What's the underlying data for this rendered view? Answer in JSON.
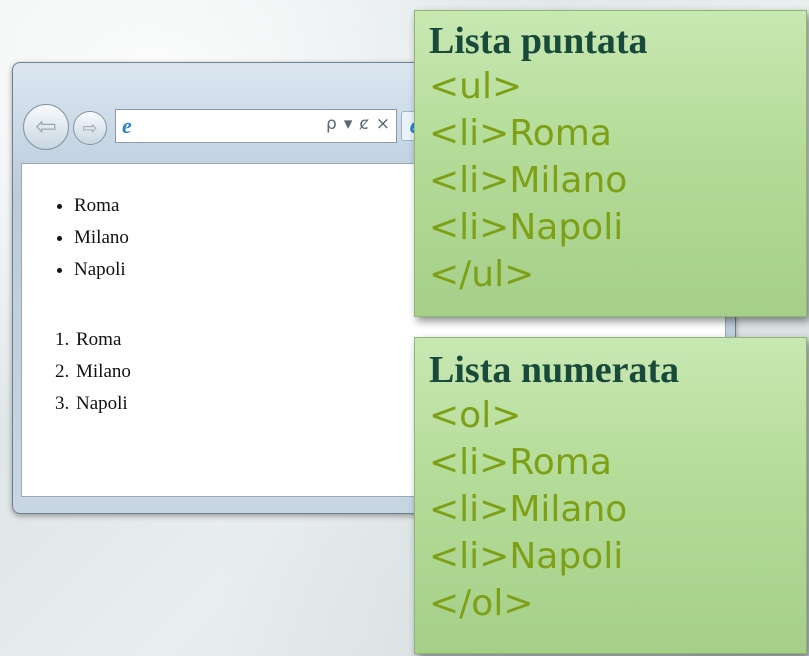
{
  "browser": {
    "back_glyph": "⇦",
    "forward_glyph": "⇨",
    "address_icon": "e",
    "address_tools": [
      "ρ",
      "▾",
      "ȼ",
      "×"
    ],
    "tab_icon": "e"
  },
  "page": {
    "unordered_items": [
      "Roma",
      "Milano",
      "Napoli"
    ],
    "ordered_items": [
      "Roma",
      "Milano",
      "Napoli"
    ]
  },
  "panels": {
    "bulleted": {
      "title": "Lista puntata",
      "lines": [
        "<ul>",
        "<li>Roma",
        "<li>Milano",
        "<li>Napoli",
        "</ul>"
      ]
    },
    "numbered": {
      "title": "Lista numerata",
      "lines": [
        "<ol>",
        "<li>Roma",
        "<li>Milano",
        "<li>Napoli",
        "</ol>"
      ]
    }
  },
  "colors": {
    "panel_title": "#174a3a",
    "code_text": "#7da017",
    "panel_bg": "#b4dc98"
  }
}
